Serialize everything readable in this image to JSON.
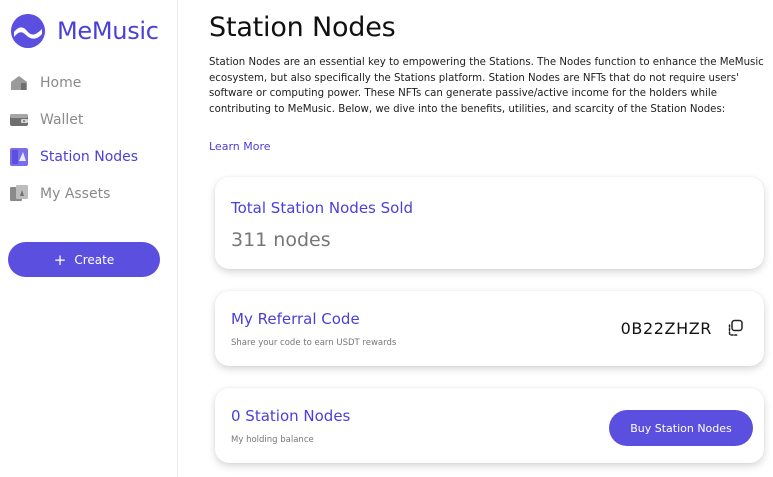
{
  "app": {
    "name": "MeMusic"
  },
  "sidebar": {
    "items": [
      {
        "label": "Home",
        "icon": "home-icon"
      },
      {
        "label": "Wallet",
        "icon": "wallet-icon"
      },
      {
        "label": "Station Nodes",
        "icon": "station-nodes-icon",
        "active": true
      },
      {
        "label": "My Assets",
        "icon": "assets-icon"
      }
    ],
    "create_label": "Create"
  },
  "main": {
    "title": "Station Nodes",
    "intro": "Station Nodes are an essential key to empowering the Stations. The Nodes function to enhance the MeMusic ecosystem, but also specifically the Stations platform. Station Nodes are NFTs that do not require users' software or computing power. These NFTs can generate passive/active income for the holders while contributing to MeMusic. Below, we dive into the benefits, utilities, and scarcity of the Station Nodes:",
    "learn_more": "Learn More"
  },
  "cards": {
    "sold": {
      "title": "Total Station Nodes Sold",
      "value": "311 nodes"
    },
    "referral": {
      "title": "My Referral Code",
      "subtitle": "Share your code to earn USDT rewards",
      "code": "0B22ZHZR"
    },
    "holdings": {
      "title": "0 Station Nodes",
      "subtitle": "My holding balance",
      "button": "Buy Station Nodes"
    }
  },
  "colors": {
    "accent": "#5b4fe0",
    "accent_text": "#4b3fd9",
    "muted": "#8a8a8a"
  }
}
